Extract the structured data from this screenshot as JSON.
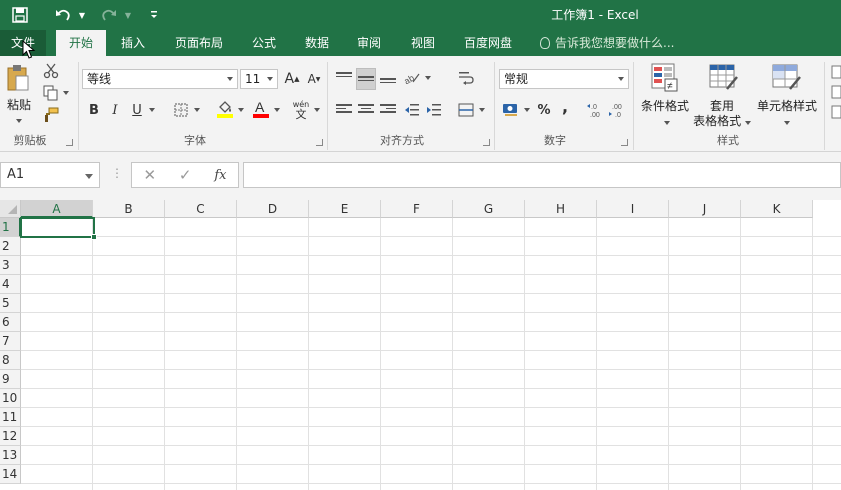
{
  "window": {
    "title": "工作簿1 - Excel"
  },
  "quick_access": {
    "save_icon": "save-icon",
    "undo_icon": "undo-icon",
    "redo_icon": "redo-icon",
    "customize_icon": "customize-icon"
  },
  "menu": {
    "file": "文件",
    "tabs": [
      "开始",
      "插入",
      "页面布局",
      "公式",
      "数据",
      "审阅",
      "视图",
      "百度网盘"
    ],
    "active_tab": "开始",
    "tell_me": "告诉我您想要做什么..."
  },
  "ribbon": {
    "clipboard": {
      "label": "剪贴板",
      "paste": "粘贴"
    },
    "font": {
      "label": "字体",
      "font_name": "等线",
      "font_size": "11",
      "bold": "B",
      "italic": "I",
      "underline": "U",
      "grow": "A",
      "shrink": "A",
      "phonetic_top": "wén",
      "phonetic_bottom": "文",
      "fill_color": "#ffff00",
      "font_color": "#ff0000"
    },
    "alignment": {
      "label": "对齐方式"
    },
    "number": {
      "label": "数字",
      "format": "常规",
      "percent": "%",
      "comma": ","
    },
    "styles": {
      "label": "样式",
      "conditional": "条件格式",
      "table_line1": "套用",
      "table_line2": "表格格式",
      "cell_styles": "单元格样式"
    }
  },
  "formula_bar": {
    "name_box": "A1",
    "cancel": "✕",
    "enter": "✓",
    "fx": "fx",
    "content": ""
  },
  "grid": {
    "columns": [
      "A",
      "B",
      "C",
      "D",
      "E",
      "F",
      "G",
      "H",
      "I",
      "J",
      "K"
    ],
    "rows": [
      "1",
      "2",
      "3",
      "4",
      "5",
      "6",
      "7",
      "8",
      "9",
      "10",
      "11",
      "12",
      "13",
      "14"
    ],
    "selected_column": "A",
    "selected_row": "1",
    "accent": "#217346"
  }
}
